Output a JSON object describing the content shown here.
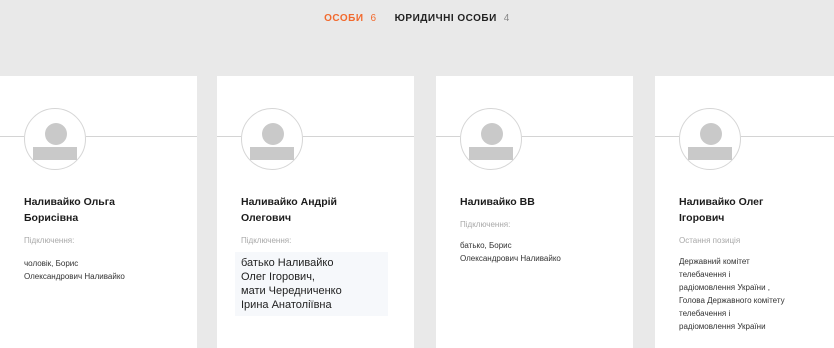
{
  "tabs": [
    {
      "label": "ОСОБИ",
      "count": "6"
    },
    {
      "label": "ЮРИДИЧНІ ОСОБИ",
      "count": "4"
    }
  ],
  "cards": [
    {
      "name_line1": "Наливайко Ольга",
      "name_line2": "Борисівна",
      "label": "Підключення:",
      "value_lines": [
        "чоловік, Борис",
        "Олександрович Наливайко"
      ]
    },
    {
      "name_line1": "Наливайко Андрій",
      "name_line2": "Олегович",
      "label": "Підключення:",
      "value_lines": [
        "батько Наливайко",
        "Олег Ігорович,",
        "мати Чередниченко",
        "Ірина Анатоліївна"
      ]
    },
    {
      "name_line1": "Наливайко ВВ",
      "label": "Підключення:",
      "value_lines": [
        "батько, Борис",
        "Олександрович Наливайко"
      ]
    },
    {
      "name_line1": "Наливайко Олег",
      "name_line2": "Ігорович",
      "label": "Остання позиція",
      "value_lines": [
        "Державний комітет",
        "телебачення і",
        "радіомовлення України ,",
        "Голова Державного комітету",
        "телебачення і",
        "радіомовлення України"
      ]
    }
  ],
  "icons": {
    "avatar": "user-placeholder-icon"
  },
  "colors": {
    "accent": "#f26a2e",
    "background": "#e9e9e9"
  }
}
